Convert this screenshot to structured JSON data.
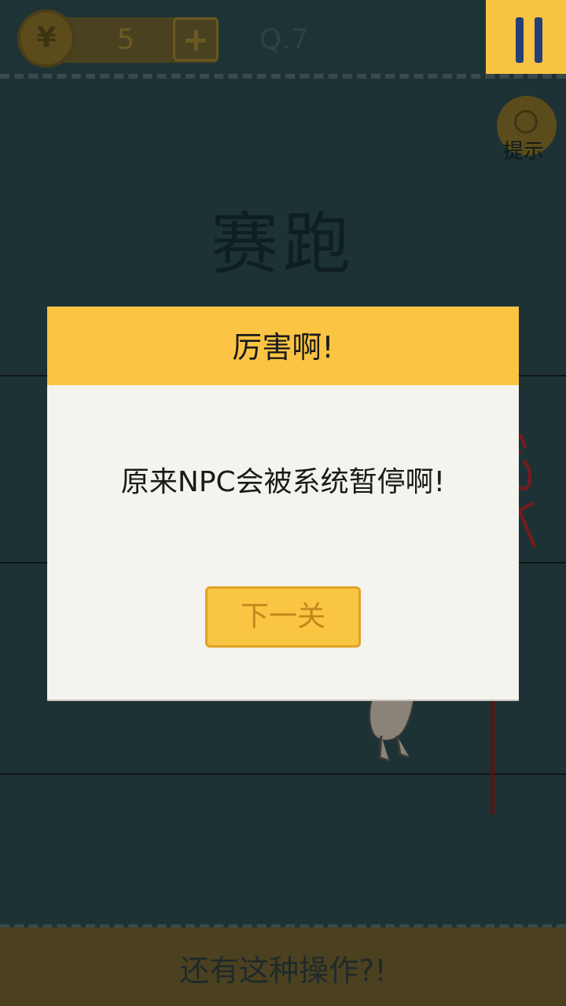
{
  "header": {
    "coin_symbol": "¥",
    "coin_count": "5",
    "level": "Q.7"
  },
  "hint": {
    "label": "提示"
  },
  "stage": {
    "title": "赛跑"
  },
  "dialog": {
    "title": "厉害啊!",
    "message": "原来NPC会被系统暂停啊!",
    "next_button_label": "下一关"
  },
  "footer": {
    "text": "还有这种操作?!"
  },
  "colors": {
    "accent": "#fcc443",
    "pause_bar": "#263f77",
    "background": "#1d3234",
    "dialog_body": "#f4f3ee"
  }
}
